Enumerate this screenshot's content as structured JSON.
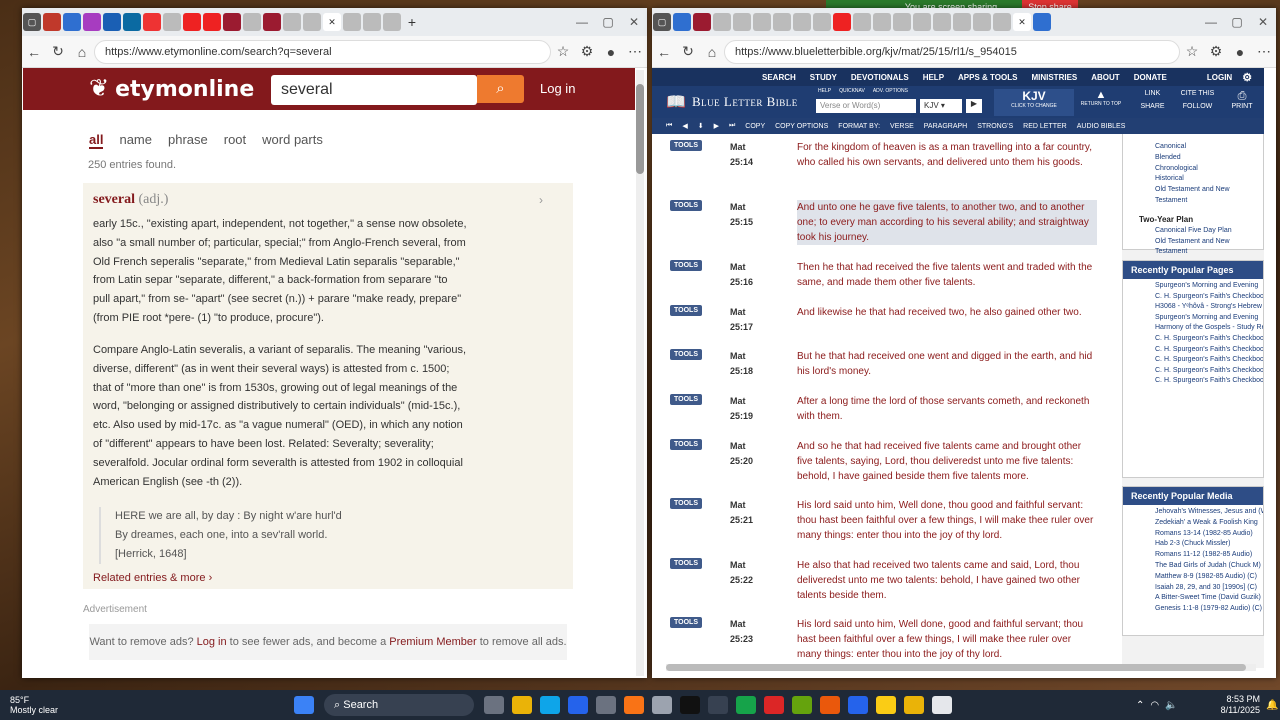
{
  "screen_share": {
    "status": "You are screen sharing",
    "stop": "Stop share"
  },
  "left": {
    "url": "https://www.etymonline.com/search?q=several",
    "logo": "etymonline",
    "search_value": "several",
    "login": "Log in",
    "tabs": [
      "all",
      "name",
      "phrase",
      "root",
      "word parts"
    ],
    "count": "250 entries found.",
    "entry": {
      "word": "several",
      "pos": "(adj.)",
      "p1": "early 15c., \"existing apart, independent, not together,\" a sense now obsolete, also \"a small number of; particular, special;\" from Anglo-French several, from Old French seperalis \"separate,\" from Medieval Latin separalis \"separable,\" from Latin separ \"separate, different,\" a back-formation from separare \"to pull apart,\" from se- \"apart\" (see secret (n.)) + parare \"make ready, prepare\" (from PIE root *pere- (1) \"to produce, procure\").",
      "p2": "Compare Anglo-Latin severalis, a variant of separalis. The meaning \"various, diverse, different\" (as in went their several ways) is attested from c. 1500; that of \"more than one\" is from 1530s, growing out of legal meanings of the word, \"belonging or assigned distributively to certain individuals\" (mid-15c.), etc. Also used by mid-17c. as \"a vague numeral\" (OED), in which any notion of \"different\" appears to have been lost. Related: Severalty; severality; severalfold. Jocular ordinal form severalth is attested from 1902 in colloquial American English (see -th (2)).",
      "quote": [
        "HERE we are all, by day : By night w'are hurl'd",
        "By dreames, each one, into a sev'rall world.",
        "[Herrick, 1648]"
      ],
      "related": "Related entries & more"
    },
    "ad_label": "Advertisement",
    "ad_text_pre": "Want to remove ads? ",
    "ad_login": "Log in",
    "ad_text_mid": " to see fewer ads, and become a ",
    "ad_premium": "Premium Member",
    "ad_text_post": " to remove all ads."
  },
  "right": {
    "url": "https://www.blueletterbible.org/kjv/mat/25/15/rl1/s_954015",
    "nav": [
      "SEARCH",
      "STUDY",
      "DEVOTIONALS",
      "HELP",
      "APPS & TOOLS",
      "MINISTRIES",
      "ABOUT",
      "DONATE"
    ],
    "nav_login": "LOGIN",
    "brand": "Blue Letter Bible",
    "search_placeholder": "Verse or Word(s)",
    "version": "KJV",
    "version_big": "KJV",
    "version_sub": "CLICK TO CHANGE",
    "return_top": "RETURN TO TOP",
    "right_btns": [
      "LINK",
      "CITE THIS",
      "SHARE",
      "FOLLOW",
      "PRINT"
    ],
    "small_links": [
      "HELP",
      "QUICKNAV",
      "ADV. OPTIONS"
    ],
    "toolbar": [
      "COPY",
      "COPY OPTIONS",
      "FORMAT BY:",
      "VERSE",
      "PARAGRAPH",
      "STRONG'S",
      "RED LETTER",
      "AUDIO BIBLES"
    ],
    "tools_label": "TOOLS",
    "verses": [
      {
        "ref": "Mat 25:14",
        "text": "For the kingdom of heaven is as a man travelling into a far country, who called his own servants, and delivered unto them his goods."
      },
      {
        "ref": "Mat 25:15",
        "text": "And unto one he gave five talents, to another two, and to another one; to every man according to his several ability; and straightway took his journey."
      },
      {
        "ref": "Mat 25:16",
        "text": "Then he that had received the five talents went and traded with the same, and made them other five talents."
      },
      {
        "ref": "Mat 25:17",
        "text": "And likewise he that had received two, he also gained other two."
      },
      {
        "ref": "Mat 25:18",
        "text": "But he that had received one went and digged in the earth, and hid his lord's money."
      },
      {
        "ref": "Mat 25:19",
        "text": "After a long time the lord of those servants cometh, and reckoneth with them."
      },
      {
        "ref": "Mat 25:20",
        "text": "And so he that had received five talents came and brought other five talents, saying, Lord, thou deliveredst unto me five talents: behold, I have gained beside them five talents more."
      },
      {
        "ref": "Mat 25:21",
        "text": "His lord said unto him, Well done, thou good and faithful servant: thou hast been faithful over a few things, I will make thee ruler over many things: enter thou into the joy of thy lord."
      },
      {
        "ref": "Mat 25:22",
        "text": "He also that had received two talents came and said, Lord, thou deliveredst unto me two talents: behold, I have gained two other talents beside them."
      },
      {
        "ref": "Mat 25:23",
        "text": "His lord said unto him, Well done, good and faithful servant; thou hast been faithful over a few things, I will make thee ruler over many things: enter thou into the joy of thy lord."
      }
    ],
    "plan_items": [
      "Canonical",
      "Blended",
      "Chronological",
      "Historical",
      "Old Testament and New Testament"
    ],
    "two_year_title": "Two-Year Plan",
    "two_year_items": [
      "Canonical Five Day Plan",
      "Old Testament and New Testament"
    ],
    "popular_pages_title": "Recently Popular Pages",
    "popular_pages": [
      "Spurgeon's Morning and Evening",
      "C. H. Spurgeon's Faith's Checkbook (July 10th)",
      "H3068 - Yᵉhôvâ - Strong's Hebrew",
      "Spurgeon's Morning and Evening",
      "Harmony of the Gospels - Study Resources",
      "C. H. Spurgeon's Faith's Checkbook (February 12th)",
      "C. H. Spurgeon's Faith's Checkbook (July 3rd)",
      "C. H. Spurgeon's Faith's Checkbook (July 11th)",
      "C. H. Spurgeon's Faith's Checkbook (July 11th)",
      "C. H. Spurgeon's Faith's Checkbook (July 30th)"
    ],
    "popular_media_title": "Recently Popular Media",
    "popular_media": [
      "Jehovah's Witnesses, Jesus and (Walter Martin)",
      "Zedekiah' a Weak & Foolish King",
      "Romans 13-14 (1982-85 Audio)",
      "Hab 2-3 (Chuck Missler)",
      "Romans 11-12 (1982-85 Audio)",
      "The Bad Girls of Judah (Chuck M)",
      "Matthew 8-9 (1982-85 Audio) (C)",
      "Isaiah 28, 29, and 30 [1990s] (C)",
      "A Bitter-Sweet Time (David Guzik)",
      "Genesis 1:1-8 (1979-82 Audio) (C)"
    ]
  },
  "taskbar": {
    "weather": "85°F",
    "weather_sub": "Mostly clear",
    "search": "Search",
    "time": "8:53 PM",
    "date": "8/11/2025"
  },
  "colors": {
    "ety": "#83191c",
    "blb": "#1f3d72",
    "verse": "#8b1a1a"
  }
}
